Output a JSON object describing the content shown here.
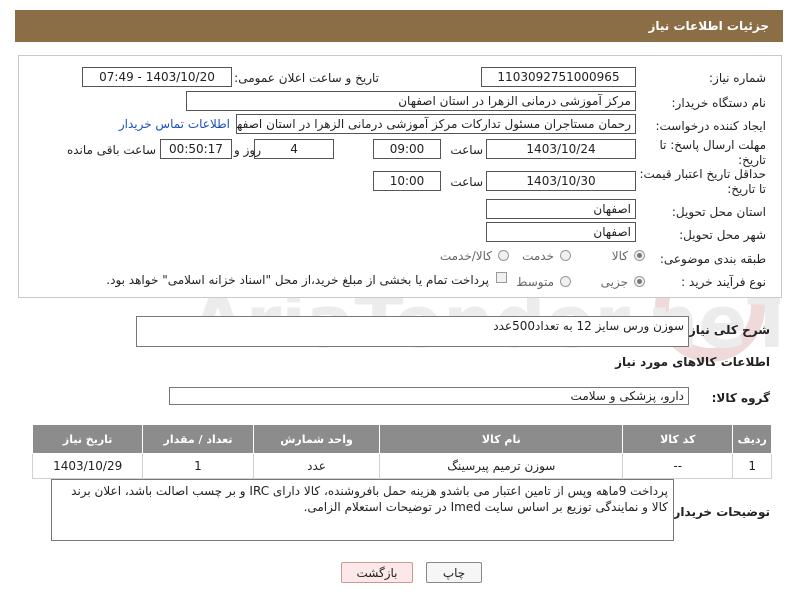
{
  "header": {
    "title": "جزئیات اطلاعات نیاز"
  },
  "form": {
    "need_number_label": "شماره نیاز:",
    "need_number": "1103092751000965",
    "announce_label": "تاریخ و ساعت اعلان عمومی:",
    "announce_value": "1403/10/20 - 07:49",
    "buyer_org_label": "نام دستگاه خریدار:",
    "buyer_org": "مرکز آموزشی درمانی الزهرا در استان اصفهان",
    "creator_label": "ایجاد کننده درخواست:",
    "creator": "رحمان مستاجران مسئول تدارکات مرکز آموزشی درمانی الزهرا در استان اصفهان",
    "contact_link": "اطلاعات تماس خریدار",
    "reply_deadline_label": "مهلت ارسال پاسخ: تا تاریخ:",
    "reply_date": "1403/10/24",
    "time_label": "ساعت",
    "reply_time": "09:00",
    "days_value": "4",
    "days_label": "روز و",
    "remaining_value": "00:50:17",
    "remaining_label": "ساعت باقی مانده",
    "price_validity_label": "حداقل تاریخ اعتبار قیمت: تا تاریخ:",
    "price_date": "1403/10/30",
    "price_time": "10:00",
    "province_label": "استان محل تحویل:",
    "province": "اصفهان",
    "city_label": "شهر محل تحویل:",
    "city": "اصفهان",
    "category_label": "طبقه بندی موضوعی:",
    "category_options": [
      "کالا",
      "خدمت",
      "کالا/خدمت"
    ],
    "process_label": "نوع فرآیند خرید :",
    "process_options": [
      "جزیی",
      "متوسط"
    ],
    "payment_note": "پرداخت تمام یا بخشی از مبلغ خرید،از محل \"اسناد خزانه اسلامی\" خواهد بود."
  },
  "description": {
    "label": "شرح کلی نیاز:",
    "value": "سوزن ورس سایز 12 به تعداد500عدد"
  },
  "goods": {
    "section_title": "اطلاعات کالاهای مورد نیاز",
    "group_label": "گروه کالا:",
    "group_value": "دارو، پزشکی و سلامت",
    "columns": [
      "ردیف",
      "کد کالا",
      "نام کالا",
      "واحد شمارش",
      "تعداد / مقدار",
      "تاریخ نیاز"
    ],
    "rows": [
      [
        "1",
        "--",
        "سوزن ترمیم پیرسینگ",
        "عدد",
        "1",
        "1403/10/29"
      ]
    ]
  },
  "buyer_notes": {
    "label": "توضیحات خریدار:",
    "value": "پرداخت 9ماهه  وپس از تامین اعتبار می باشدو هزینه حمل بافروشنده، کالا دارای IRC و بر چسب اصالت باشد، اعلان برند کالا و نمایندگی توزیع بر اساس سایت Imed در توضیحات استعلام الزامی."
  },
  "buttons": {
    "print": "چاپ",
    "back": "بازگشت"
  },
  "watermark": {
    "text": "AriaTender.neT"
  },
  "colors": {
    "header_bg": "#8b6d46",
    "table_header_bg": "#8c8c8c",
    "link": "#1d4fbf"
  }
}
